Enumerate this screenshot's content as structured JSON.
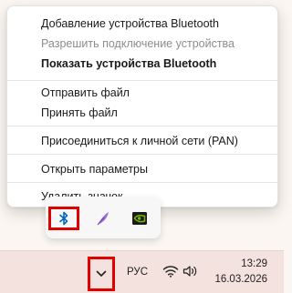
{
  "context_menu": {
    "items": [
      {
        "label": "Добавление устройства Bluetooth",
        "state": "normal"
      },
      {
        "label": "Разрешить подключение устройства",
        "state": "disabled"
      },
      {
        "label": "Показать устройства Bluetooth",
        "state": "bold"
      },
      {
        "label": "Отправить файл",
        "state": "normal"
      },
      {
        "label": "Принять файл",
        "state": "normal"
      },
      {
        "label": "Присоединиться к личной сети (PAN)",
        "state": "normal"
      },
      {
        "label": "Открыть параметры",
        "state": "normal"
      },
      {
        "label": "Удалить значок",
        "state": "normal"
      }
    ]
  },
  "tray_overflow": {
    "icons": [
      "bluetooth-icon",
      "feather-pen-icon",
      "nvidia-icon"
    ]
  },
  "taskbar": {
    "language": "РУС",
    "time": "13:29",
    "date": "16.03.2026"
  },
  "colors": {
    "highlight": "#e00000",
    "bluetooth": "#0067c0",
    "nvidia": "#76b900",
    "pen": "#9b6fd6"
  }
}
